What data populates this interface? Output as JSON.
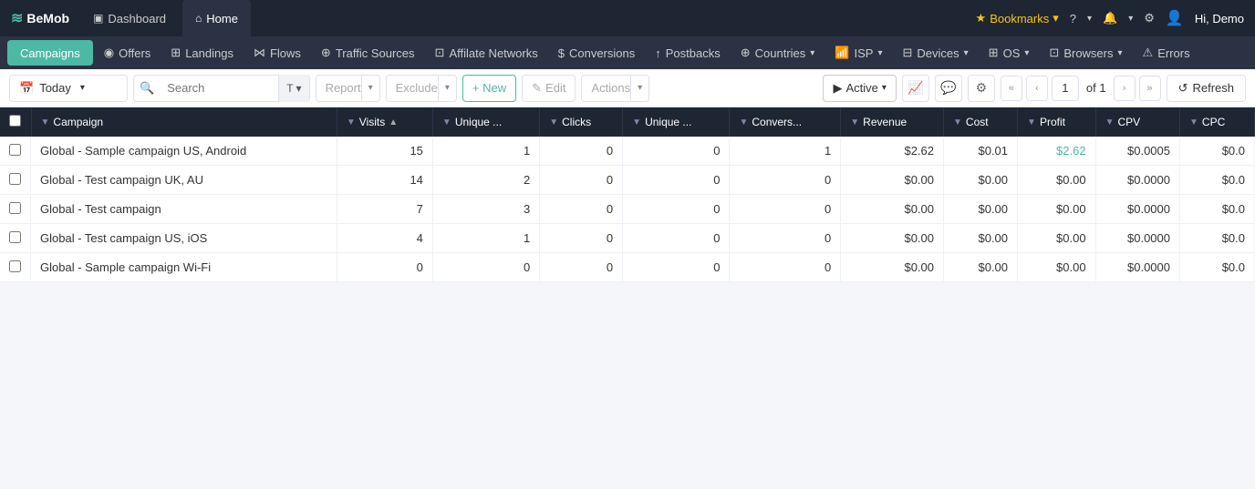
{
  "app": {
    "logo": "BeMob",
    "logo_icon": "≋"
  },
  "top_nav": {
    "tabs": [
      {
        "id": "dashboard",
        "icon": "▣",
        "label": "Dashboard",
        "active": false
      },
      {
        "id": "home",
        "icon": "⌂",
        "label": "Home",
        "active": true
      }
    ],
    "bookmarks": "Bookmarks",
    "help_icon": "?",
    "notification_icon": "🔔",
    "settings_icon": "⚙",
    "user": "Hi, Demo"
  },
  "second_nav": {
    "campaigns": "Campaigns",
    "items": [
      {
        "id": "offers",
        "icon": "◉",
        "label": "Offers"
      },
      {
        "id": "landings",
        "icon": "⊞",
        "label": "Landings"
      },
      {
        "id": "flows",
        "icon": "⋈",
        "label": "Flows"
      },
      {
        "id": "traffic-sources",
        "icon": "⊕",
        "label": "Traffic Sources"
      },
      {
        "id": "affiliate-networks",
        "icon": "⊡",
        "label": "Affilate Networks"
      },
      {
        "id": "conversions",
        "icon": "$",
        "label": "Conversions"
      },
      {
        "id": "postbacks",
        "icon": "↑",
        "label": "Postbacks"
      },
      {
        "id": "countries",
        "icon": "⊕",
        "label": "Countries",
        "arrow": true
      },
      {
        "id": "isp",
        "icon": "📶",
        "label": "ISP",
        "arrow": true
      },
      {
        "id": "devices",
        "icon": "⊟",
        "label": "Devices",
        "arrow": true
      },
      {
        "id": "os",
        "icon": "⊞",
        "label": "OS",
        "arrow": true
      },
      {
        "id": "browsers",
        "icon": "⊡",
        "label": "Browsers",
        "arrow": true
      },
      {
        "id": "errors",
        "icon": "⚠",
        "label": "Errors"
      }
    ]
  },
  "toolbar": {
    "date_label": "Today",
    "search_placeholder": "Search",
    "filter_label": "T",
    "report_label": "Report",
    "exclude_label": "Exclude",
    "new_label": "+ New",
    "edit_label": "✎ Edit",
    "actions_label": "Actions",
    "active_label": "▶ Active",
    "chart_icon": "📈",
    "comment_icon": "💬",
    "settings_icon": "⚙",
    "first_page": "«",
    "prev_page": "‹",
    "page_num": "1",
    "page_of": "of 1",
    "next_page": "›",
    "last_page": "»",
    "refresh_label": "Refresh"
  },
  "table": {
    "columns": [
      {
        "id": "campaign",
        "label": "Campaign",
        "filter": true,
        "sort": true
      },
      {
        "id": "visits",
        "label": "Visits",
        "filter": true,
        "sort": true
      },
      {
        "id": "unique1",
        "label": "Unique ...",
        "filter": true,
        "sort": false
      },
      {
        "id": "clicks",
        "label": "Clicks",
        "filter": true,
        "sort": false
      },
      {
        "id": "unique2",
        "label": "Unique ...",
        "filter": true,
        "sort": false
      },
      {
        "id": "conversions",
        "label": "Convers...",
        "filter": true,
        "sort": false
      },
      {
        "id": "revenue",
        "label": "Revenue",
        "filter": true,
        "sort": false
      },
      {
        "id": "cost",
        "label": "Cost",
        "filter": true,
        "sort": false
      },
      {
        "id": "profit",
        "label": "Profit",
        "filter": true,
        "sort": false
      },
      {
        "id": "cpv",
        "label": "CPV",
        "filter": true,
        "sort": false
      },
      {
        "id": "cpc",
        "label": "CPC",
        "filter": true,
        "sort": false
      }
    ],
    "rows": [
      {
        "campaign": "Global - Sample campaign US, Android",
        "visits": "15",
        "unique1": "1",
        "clicks": "0",
        "unique2": "0",
        "conversions": "1",
        "revenue": "$2.62",
        "cost": "$0.01",
        "profit": "$2.62",
        "profit_positive": true,
        "cpv": "$0.0005",
        "cpc": "$0.0"
      },
      {
        "campaign": "Global - Test campaign UK, AU",
        "visits": "14",
        "unique1": "2",
        "clicks": "0",
        "unique2": "0",
        "conversions": "0",
        "revenue": "$0.00",
        "cost": "$0.00",
        "profit": "$0.00",
        "profit_positive": false,
        "cpv": "$0.0000",
        "cpc": "$0.0"
      },
      {
        "campaign": "Global - Test campaign",
        "visits": "7",
        "unique1": "3",
        "clicks": "0",
        "unique2": "0",
        "conversions": "0",
        "revenue": "$0.00",
        "cost": "$0.00",
        "profit": "$0.00",
        "profit_positive": false,
        "cpv": "$0.0000",
        "cpc": "$0.0"
      },
      {
        "campaign": "Global - Test campaign US, iOS",
        "visits": "4",
        "unique1": "1",
        "clicks": "0",
        "unique2": "0",
        "conversions": "0",
        "revenue": "$0.00",
        "cost": "$0.00",
        "profit": "$0.00",
        "profit_positive": false,
        "cpv": "$0.0000",
        "cpc": "$0.0"
      },
      {
        "campaign": "Global - Sample campaign Wi-Fi",
        "visits": "0",
        "unique1": "0",
        "clicks": "0",
        "unique2": "0",
        "conversions": "0",
        "revenue": "$0.00",
        "cost": "$0.00",
        "profit": "$0.00",
        "profit_positive": false,
        "cpv": "$0.0000",
        "cpc": "$0.0"
      }
    ]
  }
}
